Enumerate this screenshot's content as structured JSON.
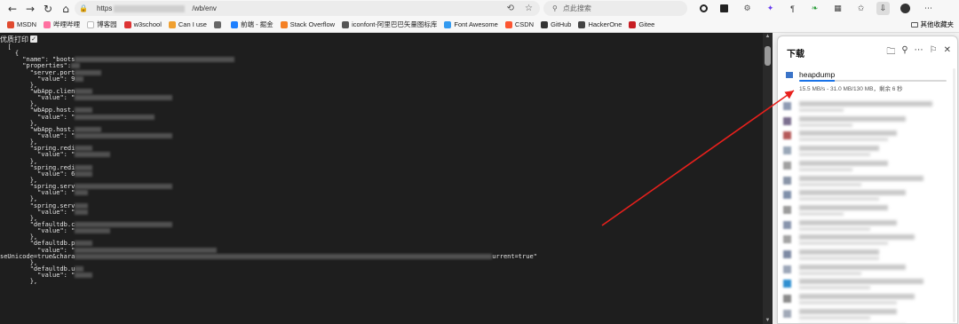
{
  "browser": {
    "url_prefix": "https",
    "url_suffix": "/wb/env",
    "search_placeholder": "点此搜索",
    "nav": {
      "back": "←",
      "forward": "→",
      "reload": "↻",
      "home": "⌂"
    }
  },
  "bookmarks": {
    "items": [
      {
        "label": "MSDN",
        "color": "#e04a2f"
      },
      {
        "label": "哔哩哔哩",
        "color": "#ff6fa0"
      },
      {
        "label": "博客园",
        "color": "#ffffff"
      },
      {
        "label": "w3school",
        "color": "#d33"
      },
      {
        "label": "Can I use",
        "color": "#f0a030"
      },
      {
        "label": "",
        "color": "#666"
      },
      {
        "label": "前端 - 掘金",
        "color": "#1e80ff"
      },
      {
        "label": "Stack Overflow",
        "color": "#f48024"
      },
      {
        "label": "iconfont-阿里巴巴矢量图标库",
        "color": "#555"
      },
      {
        "label": "Font Awesome",
        "color": "#339af0"
      },
      {
        "label": "CSDN",
        "color": "#fc5531"
      },
      {
        "label": "GitHub",
        "color": "#333"
      },
      {
        "label": "HackerOne",
        "color": "#444"
      },
      {
        "label": "Gitee",
        "color": "#c71d23"
      }
    ],
    "other_label": "其他收藏夹"
  },
  "content": {
    "pretty_print_label": "优质打印",
    "code_lines": [
      {
        "t": "[",
        "pre": "  "
      },
      {
        "t": "{",
        "pre": "    "
      },
      {
        "t": "\"name\": \"boots",
        "pre": "      ",
        "blur": 180
      },
      {
        "t": "\"properties\":",
        "pre": "      ",
        "blur": 10
      },
      {
        "t": "\"server.port",
        "pre": "        ",
        "blur": 30
      },
      {
        "t": "\"value\": 9",
        "pre": "          ",
        "blur": 10
      },
      {
        "t": "},",
        "pre": "        "
      },
      {
        "t": "\"wbApp.clien",
        "pre": "        ",
        "blur": 20
      },
      {
        "t": "\"value\": \"",
        "pre": "          ",
        "blur": 110
      },
      {
        "t": "},",
        "pre": "        "
      },
      {
        "t": "\"wbApp.host.",
        "pre": "        ",
        "blur": 20
      },
      {
        "t": "\"value\": \"",
        "pre": "          ",
        "blur": 90
      },
      {
        "t": "},",
        "pre": "        "
      },
      {
        "t": "\"wbApp.host.",
        "pre": "        ",
        "blur": 30
      },
      {
        "t": "\"value\": \"",
        "pre": "          ",
        "blur": 110
      },
      {
        "t": "},",
        "pre": "        "
      },
      {
        "t": "\"spring.redi",
        "pre": "        ",
        "blur": 20
      },
      {
        "t": "\"value\": \"",
        "pre": "          ",
        "blur": 40
      },
      {
        "t": "},",
        "pre": "        "
      },
      {
        "t": "\"spring.redi",
        "pre": "        ",
        "blur": 20
      },
      {
        "t": "\"value\": 6",
        "pre": "          ",
        "blur": 20
      },
      {
        "t": "},",
        "pre": "        "
      },
      {
        "t": "\"spring.serv",
        "pre": "        ",
        "blur": 110
      },
      {
        "t": "\"value\": \"",
        "pre": "          ",
        "blur": 15
      },
      {
        "t": "},",
        "pre": "        "
      },
      {
        "t": "\"spring.serv",
        "pre": "        ",
        "blur": 15
      },
      {
        "t": "\"value\": \"",
        "pre": "          ",
        "blur": 15
      },
      {
        "t": "},",
        "pre": "        "
      },
      {
        "t": "\"defaultdb.c",
        "pre": "        ",
        "blur": 110
      },
      {
        "t": "\"value\": \"",
        "pre": "          ",
        "blur": 40
      },
      {
        "t": "},",
        "pre": "        "
      },
      {
        "t": "\"defaultdb.p",
        "pre": "        ",
        "blur": 20
      },
      {
        "t": "\"value\": \"",
        "pre": "          ",
        "blur": 160
      },
      {
        "t": "seUnicode=true&chara",
        "pre": "",
        "blur": 470,
        "tail": "urrent=true\""
      },
      {
        "t": "},",
        "pre": "        "
      },
      {
        "t": "\"defaultdb.u",
        "pre": "        ",
        "blur": 10
      },
      {
        "t": "\"value\": \"",
        "pre": "          ",
        "blur": 20
      },
      {
        "t": "},",
        "pre": "        "
      }
    ]
  },
  "downloads": {
    "title": "下载",
    "file": {
      "name": "heapdump",
      "status": "15.5 MB/s - 31.0 MB/130 MB，剩余 6 秒",
      "progress_fraction": 0.24
    },
    "blurred_items": 16,
    "accent_color": "#1a73e8"
  },
  "annotation": {
    "arrow_color": "#e8201c"
  }
}
